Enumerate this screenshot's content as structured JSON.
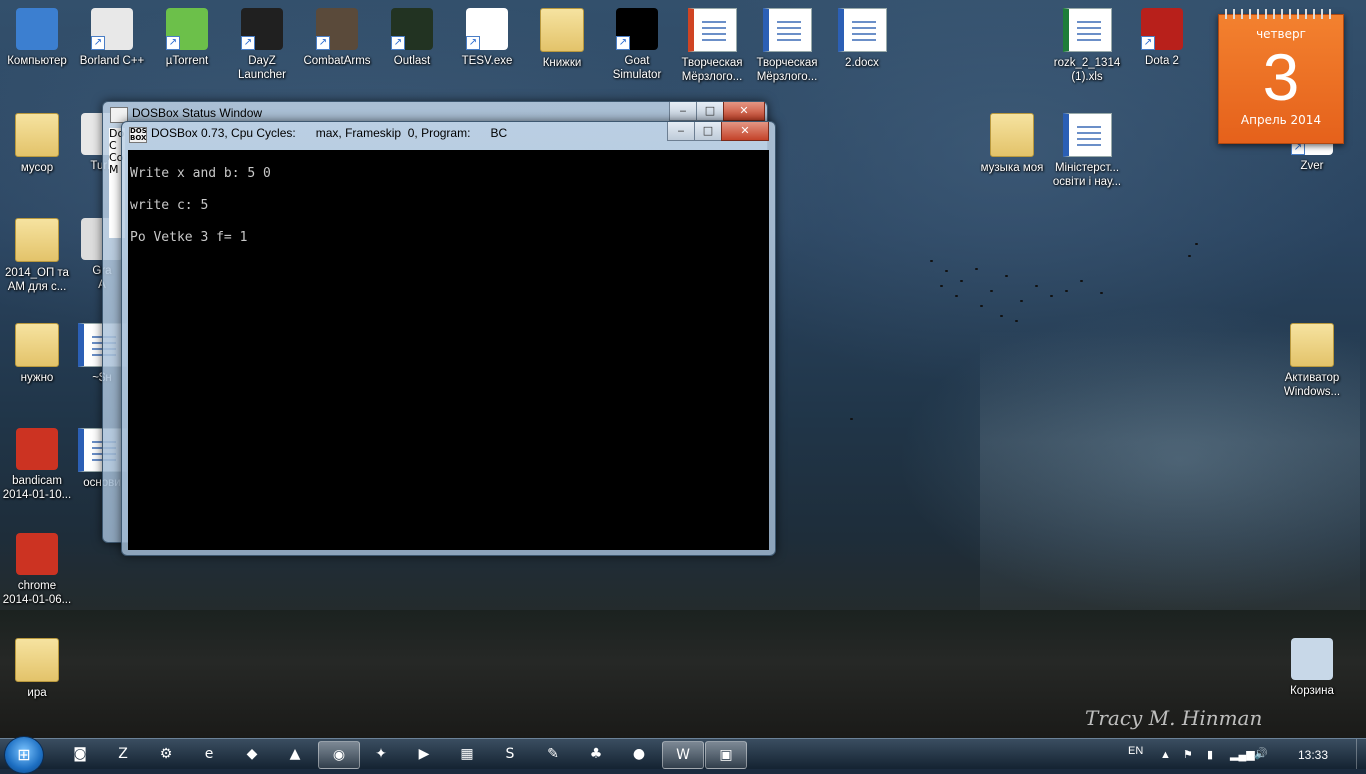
{
  "desktop": {
    "icons": [
      {
        "label": "Компьютер",
        "icon": "computer-icon",
        "color": "#3c7fd0",
        "kind": "app"
      },
      {
        "label": "Borland C++",
        "icon": "borland-icon",
        "color": "#e8e8e8",
        "kind": "app",
        "shortcut": true
      },
      {
        "label": "µTorrent",
        "icon": "utorrent-icon",
        "color": "#6cc04a",
        "kind": "app",
        "shortcut": true
      },
      {
        "label": "DayZ\nLauncher",
        "icon": "dayz-icon",
        "color": "#202020",
        "kind": "app",
        "shortcut": true
      },
      {
        "label": "CombatArms",
        "icon": "combatarms-icon",
        "color": "#5a4a3a",
        "kind": "app",
        "shortcut": true
      },
      {
        "label": "Outlast",
        "icon": "outlast-icon",
        "color": "#223322",
        "kind": "app",
        "shortcut": true
      },
      {
        "label": "TESV.exe",
        "icon": "skyrim-icon",
        "color": "#ffffff",
        "kind": "app",
        "shortcut": true
      },
      {
        "label": "Книжки",
        "icon": "folder-icon",
        "kind": "folder"
      },
      {
        "label": "Goat\nSimulator",
        "icon": "goat-icon",
        "color": "#000000",
        "kind": "app",
        "shortcut": true
      },
      {
        "label": "Творческая\nМёрзлого...",
        "icon": "powerpoint-doc-icon",
        "color": "#d04423",
        "kind": "doc"
      },
      {
        "label": "Творческая\nМёрзлого...",
        "icon": "word-doc-icon",
        "color": "#2b5fb5",
        "kind": "doc"
      },
      {
        "label": "2.docx",
        "icon": "word-doc-icon",
        "color": "#2b5fb5",
        "kind": "doc"
      },
      {
        "label": "rozk_2_1314\n(1).xls",
        "icon": "excel-doc-icon",
        "color": "#1e7d3a",
        "kind": "doc"
      },
      {
        "label": "Dota 2",
        "icon": "dota2-icon",
        "color": "#b8201b",
        "kind": "app",
        "shortcut": true
      },
      {
        "label": "мусор",
        "icon": "folder-icon",
        "kind": "folder"
      },
      {
        "label": "Turb",
        "icon": "borland-icon",
        "color": "#e8e8e8",
        "kind": "app"
      },
      {
        "label": "музыка моя",
        "icon": "music-folder-icon",
        "kind": "folder"
      },
      {
        "label": "Міністерст...\nосвіти і нау...",
        "icon": "word-doc-icon",
        "color": "#2b5fb5",
        "kind": "doc"
      },
      {
        "label": "Zver",
        "icon": "shortcut-icon",
        "color": "#ffffff",
        "kind": "app",
        "shortcut": true
      },
      {
        "label": "2014_ОП та\nAM для с...",
        "icon": "folder-icon",
        "kind": "folder"
      },
      {
        "label": "Gra\nA",
        "icon": "app-icon",
        "color": "#dddddd",
        "kind": "app"
      },
      {
        "label": "нужно",
        "icon": "folder-icon",
        "kind": "folder"
      },
      {
        "label": "~$н",
        "icon": "word-doc-icon",
        "color": "#2b5fb5",
        "kind": "doc"
      },
      {
        "label": "Активатор\nWindows...",
        "icon": "folder-icon",
        "kind": "folder"
      },
      {
        "label": "bandicam\n2014-01-10...",
        "icon": "video-icon",
        "color": "#cc3322",
        "kind": "app"
      },
      {
        "label": "основи",
        "icon": "word-doc-icon",
        "color": "#2b5fb5",
        "kind": "doc"
      },
      {
        "label": "chrome\n2014-01-06...",
        "icon": "video-icon",
        "color": "#cc3322",
        "kind": "app"
      },
      {
        "label": "ира",
        "icon": "folder-icon",
        "kind": "folder"
      },
      {
        "label": "Корзина",
        "icon": "recycle-bin-icon",
        "color": "#c8d8e8",
        "kind": "app"
      }
    ]
  },
  "calendar": {
    "day_of_week": "четверг",
    "day": "3",
    "month_year": "Апрель 2014"
  },
  "status_window": {
    "title": "DOSBox Status Window",
    "min": "‒",
    "max": "□",
    "close": "✕"
  },
  "dosbox_window": {
    "title": "DOSBox 0.73, Cpu Cycles:      max, Frameskip  0, Program:      BC",
    "min": "‒",
    "max": "□",
    "close": "✕",
    "console_lines": [
      "Write x and b: 5 0",
      "write c: 5",
      "Po Vetke 3 f= 1"
    ]
  },
  "behind_window_fragments": [
    "Do",
    "C",
    "Co",
    "M"
  ],
  "signature": "Tracy M. Hinman",
  "taskbar": {
    "start": "⊞",
    "items": [
      {
        "name": "tb-camera-icon",
        "glyph": "◙"
      },
      {
        "name": "tb-filezilla-icon",
        "glyph": "Z"
      },
      {
        "name": "tb-steam-icon",
        "glyph": "⚙"
      },
      {
        "name": "tb-ie-icon",
        "glyph": "e"
      },
      {
        "name": "tb-wot-icon",
        "glyph": "◆"
      },
      {
        "name": "tb-avast-icon",
        "glyph": "▲"
      },
      {
        "name": "tb-chrome-icon",
        "glyph": "◉",
        "active": true
      },
      {
        "name": "tb-app-icon",
        "glyph": "✦"
      },
      {
        "name": "tb-media-icon",
        "glyph": "▶"
      },
      {
        "name": "tb-paint-icon",
        "glyph": "▦"
      },
      {
        "name": "tb-skype-icon",
        "glyph": "S"
      },
      {
        "name": "tb-tool-icon",
        "glyph": "✎"
      },
      {
        "name": "tb-game-icon",
        "glyph": "♣"
      },
      {
        "name": "tb-record-icon",
        "glyph": "●"
      },
      {
        "name": "tb-word-icon",
        "glyph": "W",
        "active": true
      },
      {
        "name": "tb-dosbox-icon",
        "glyph": "▣",
        "active": true
      }
    ],
    "language": "EN",
    "clock": "13:33"
  }
}
